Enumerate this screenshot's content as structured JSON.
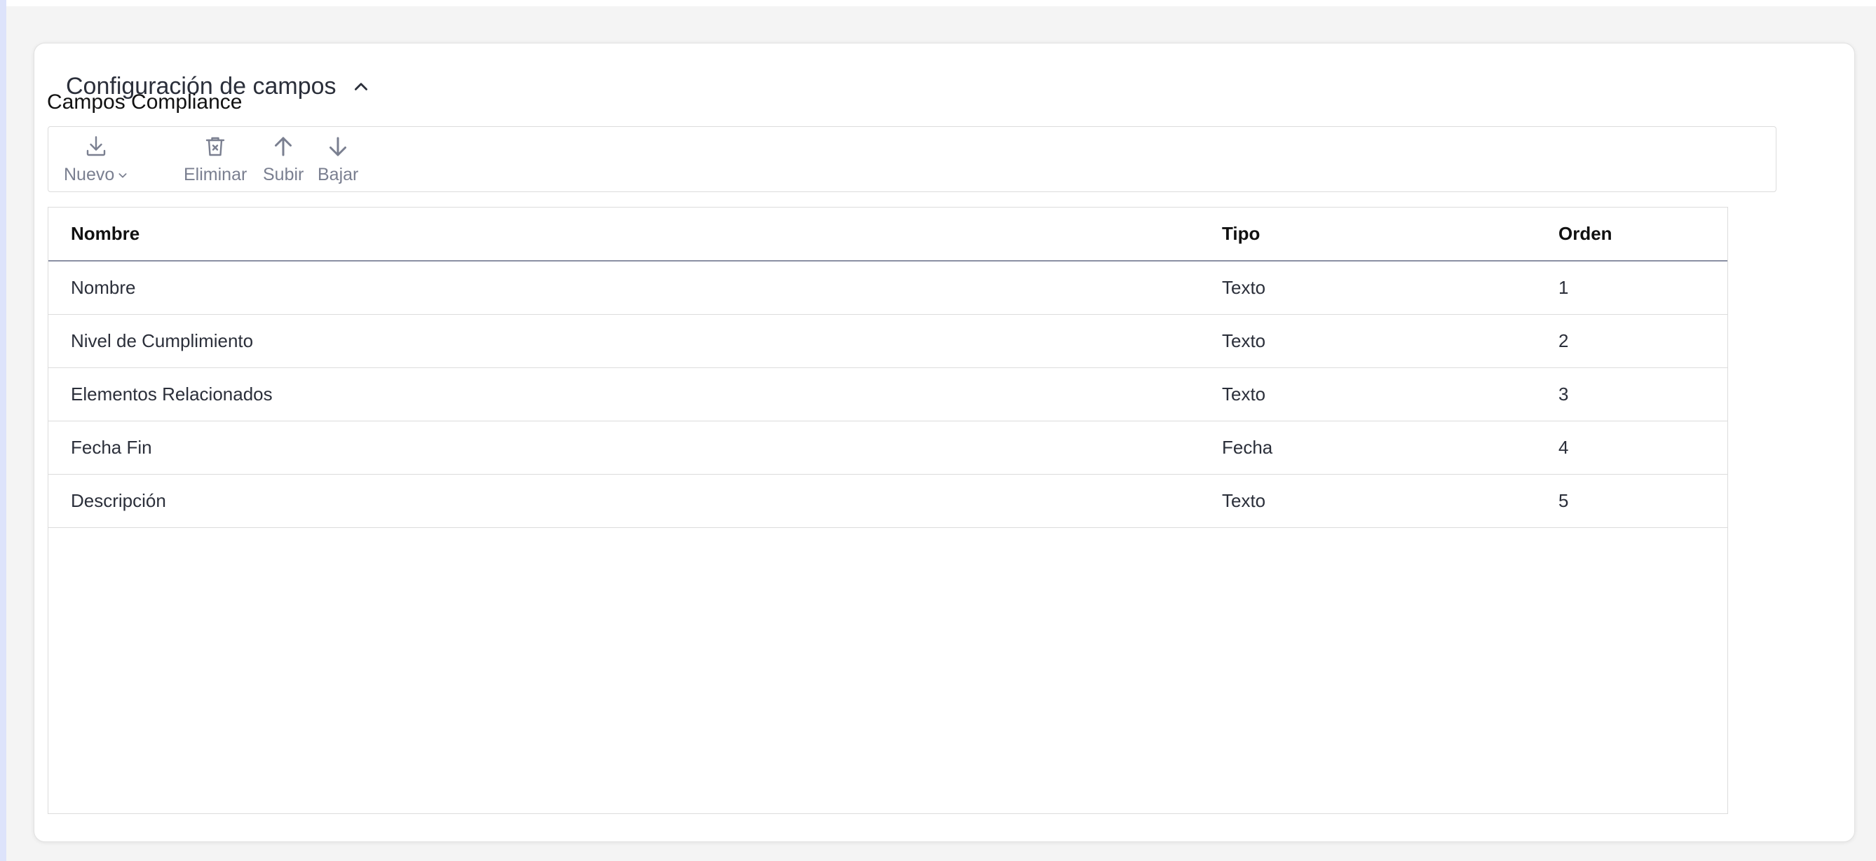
{
  "section": {
    "title": "Configuración de campos",
    "collapse_icon": "chevron-up-icon"
  },
  "subsection": {
    "title": "Campos Compliance"
  },
  "toolbar": {
    "new_label": "Nuevo",
    "new_icon": "download-icon",
    "delete_label": "Eliminar",
    "delete_icon": "trash-icon",
    "up_label": "Subir",
    "up_icon": "arrow-up-icon",
    "down_label": "Bajar",
    "down_icon": "arrow-down-icon"
  },
  "table": {
    "columns": [
      "Nombre",
      "Tipo",
      "Orden"
    ],
    "rows": [
      [
        "Nombre",
        "Texto",
        "1"
      ],
      [
        "Nivel de Cumplimiento",
        "Texto",
        "2"
      ],
      [
        "Elementos Relacionados",
        "Texto",
        "3"
      ],
      [
        "Fecha Fin",
        "Fecha",
        "4"
      ],
      [
        "Descripción",
        "Texto",
        "5"
      ]
    ]
  },
  "colors": {
    "background": "#f4f4f4",
    "card": "#ffffff",
    "accent_left": "#dde3fb",
    "icon_gray": "#7a7f90",
    "header_border": "#8a8fa3"
  }
}
